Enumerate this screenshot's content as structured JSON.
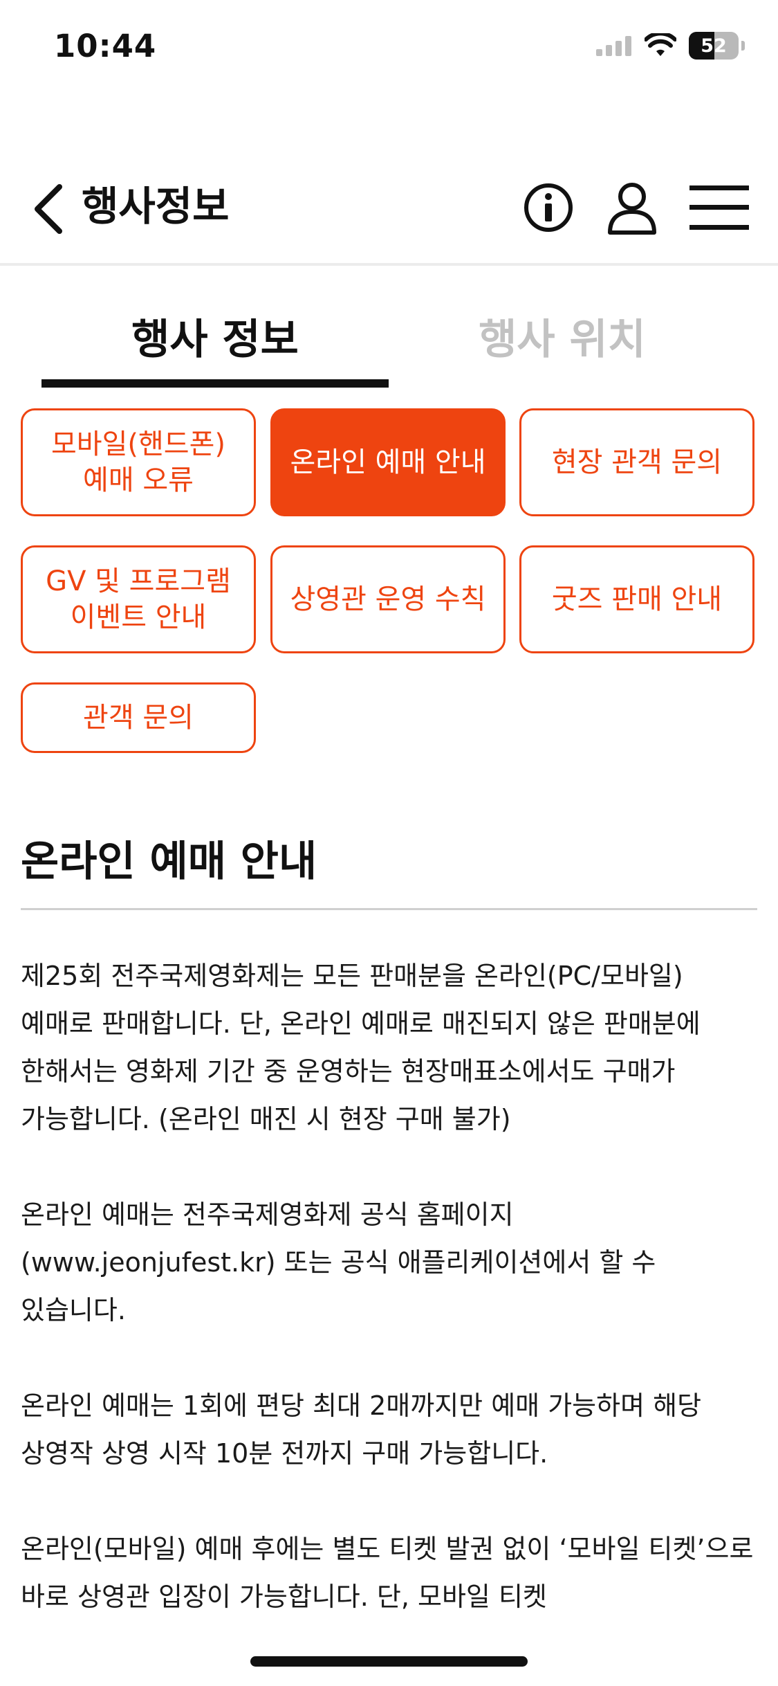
{
  "status_bar": {
    "time": "10:44",
    "battery_level": "52",
    "battery_percent": 52
  },
  "header": {
    "title": "행사정보",
    "back_icon": "chevron-left-icon",
    "info_icon": "info-icon",
    "user_icon": "user-icon",
    "menu_icon": "hamburger-menu-icon"
  },
  "tabs": [
    {
      "label": "행사 정보",
      "active": true
    },
    {
      "label": "행사 위치",
      "active": false
    }
  ],
  "categories": [
    {
      "label": "모바일(핸드폰)\n예매 오류",
      "active": false
    },
    {
      "label": "온라인 예매 안내",
      "active": true
    },
    {
      "label": "현장 관객 문의",
      "active": false
    },
    {
      "label": "GV 및 프로그램\n이벤트 안내",
      "active": false
    },
    {
      "label": "상영관 운영 수칙",
      "active": false
    },
    {
      "label": "굿즈 판매 안내",
      "active": false
    },
    {
      "label": "관객 문의",
      "active": false
    }
  ],
  "section": {
    "title": "온라인 예매 안내",
    "paragraphs": [
      "제25회 전주국제영화제는 모든 판매분을 온라인(PC/모바일) 예매로 판매합니다. 단, 온라인 예매로 매진되지 않은 판매분에 한해서는 영화제 기간 중 운영하는 현장매표소에서도 구매가 가능합니다. (온라인 매진 시 현장 구매 불가)",
      "온라인 예매는 전주국제영화제 공식 홈페이지(www.jeonjufest.kr) 또는 공식 애플리케이션에서 할 수 있습니다.",
      "온라인 예매는 1회에 편당 최대 2매까지만 예매 가능하며 해당 상영작 상영 시작 10분 전까지 구매 가능합니다.",
      "온라인(모바일) 예매 후에는 별도 티켓 발권 없이 ‘모바일 티켓’으로 바로 상영관 입장이 가능합니다. 단, 모바일 티켓"
    ]
  },
  "colors": {
    "accent": "#ee4410",
    "text": "#111111",
    "inactive_tab": "#c2c2c2"
  }
}
